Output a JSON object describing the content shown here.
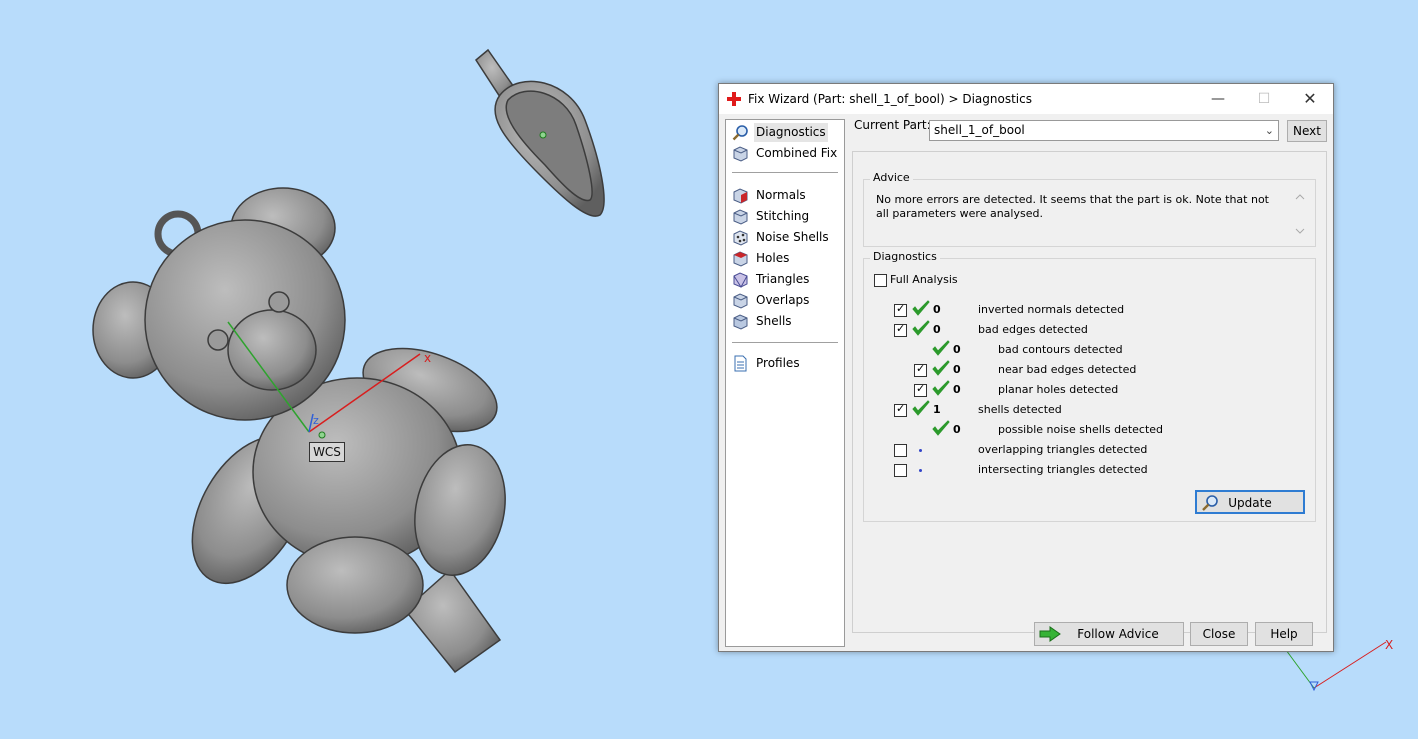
{
  "viewport": {
    "wcs_label": "WCS",
    "x_axis_label": "x",
    "z_axis_label": "z",
    "corner_x_label": "X",
    "colors": {
      "background": "#b8dcfb",
      "model": "#8a8a8a",
      "x_axis": "#d81e1e",
      "y_axis": "#2ea32e",
      "z_axis": "#2f5fd8"
    }
  },
  "dialog": {
    "title": "Fix Wizard (Part: shell_1_of_bool) > Diagnostics",
    "title_icon": "red-cross-icon",
    "nav": {
      "group1": [
        {
          "label": "Diagnostics",
          "icon": "magnifier-icon",
          "selected": true
        },
        {
          "label": "Combined Fix",
          "icon": "cube-icon",
          "selected": false
        }
      ],
      "group2": [
        {
          "label": "Normals",
          "icon": "normals-cube-icon"
        },
        {
          "label": "Stitching",
          "icon": "stitching-cube-icon"
        },
        {
          "label": "Noise Shells",
          "icon": "noise-shells-icon"
        },
        {
          "label": "Holes",
          "icon": "holes-cube-icon"
        },
        {
          "label": "Triangles",
          "icon": "triangles-cube-icon"
        },
        {
          "label": "Overlaps",
          "icon": "overlaps-cube-icon"
        },
        {
          "label": "Shells",
          "icon": "shells-cube-icon"
        }
      ],
      "group3": [
        {
          "label": "Profiles",
          "icon": "document-icon"
        }
      ]
    },
    "current_part": {
      "label": "Current Part:",
      "value": "shell_1_of_bool"
    },
    "next_label": "Next",
    "advice": {
      "title": "Advice",
      "text": "No more errors are detected. It seems that the part is ok. Note that not all parameters were analysed."
    },
    "diagnostics": {
      "title": "Diagnostics",
      "full_analysis": {
        "label": "Full Analysis",
        "checked": false
      },
      "rows": [
        {
          "checkbox": true,
          "checked": true,
          "status": "ok",
          "count": "0",
          "label": "inverted normals detected",
          "indent": 0
        },
        {
          "checkbox": true,
          "checked": true,
          "status": "ok",
          "count": "0",
          "label": "bad edges detected",
          "indent": 0
        },
        {
          "checkbox": false,
          "checked": false,
          "status": "ok",
          "count": "0",
          "label": "bad contours detected",
          "indent": 1
        },
        {
          "checkbox": true,
          "checked": true,
          "status": "ok",
          "count": "0",
          "label": "near bad edges detected",
          "indent": 1
        },
        {
          "checkbox": true,
          "checked": true,
          "status": "ok",
          "count": "0",
          "label": "planar holes detected",
          "indent": 1
        },
        {
          "checkbox": true,
          "checked": true,
          "status": "ok",
          "count": "1",
          "label": "shells detected",
          "indent": 0
        },
        {
          "checkbox": false,
          "checked": false,
          "status": "ok",
          "count": "0",
          "label": "possible noise shells detected",
          "indent": 1
        },
        {
          "checkbox": true,
          "checked": false,
          "status": "pending",
          "count": "",
          "label": "overlapping triangles detected",
          "indent": 0
        },
        {
          "checkbox": true,
          "checked": false,
          "status": "pending",
          "count": "",
          "label": "intersecting triangles detected",
          "indent": 0
        }
      ],
      "update_label": "Update"
    },
    "buttons": {
      "follow_advice": "Follow Advice",
      "close": "Close",
      "help": "Help"
    },
    "colors": {
      "check_green": "#2c9a2c",
      "pending_dot": "#3244c9",
      "update_border": "#2f7cd2",
      "arrow_green": "#36b336"
    }
  }
}
